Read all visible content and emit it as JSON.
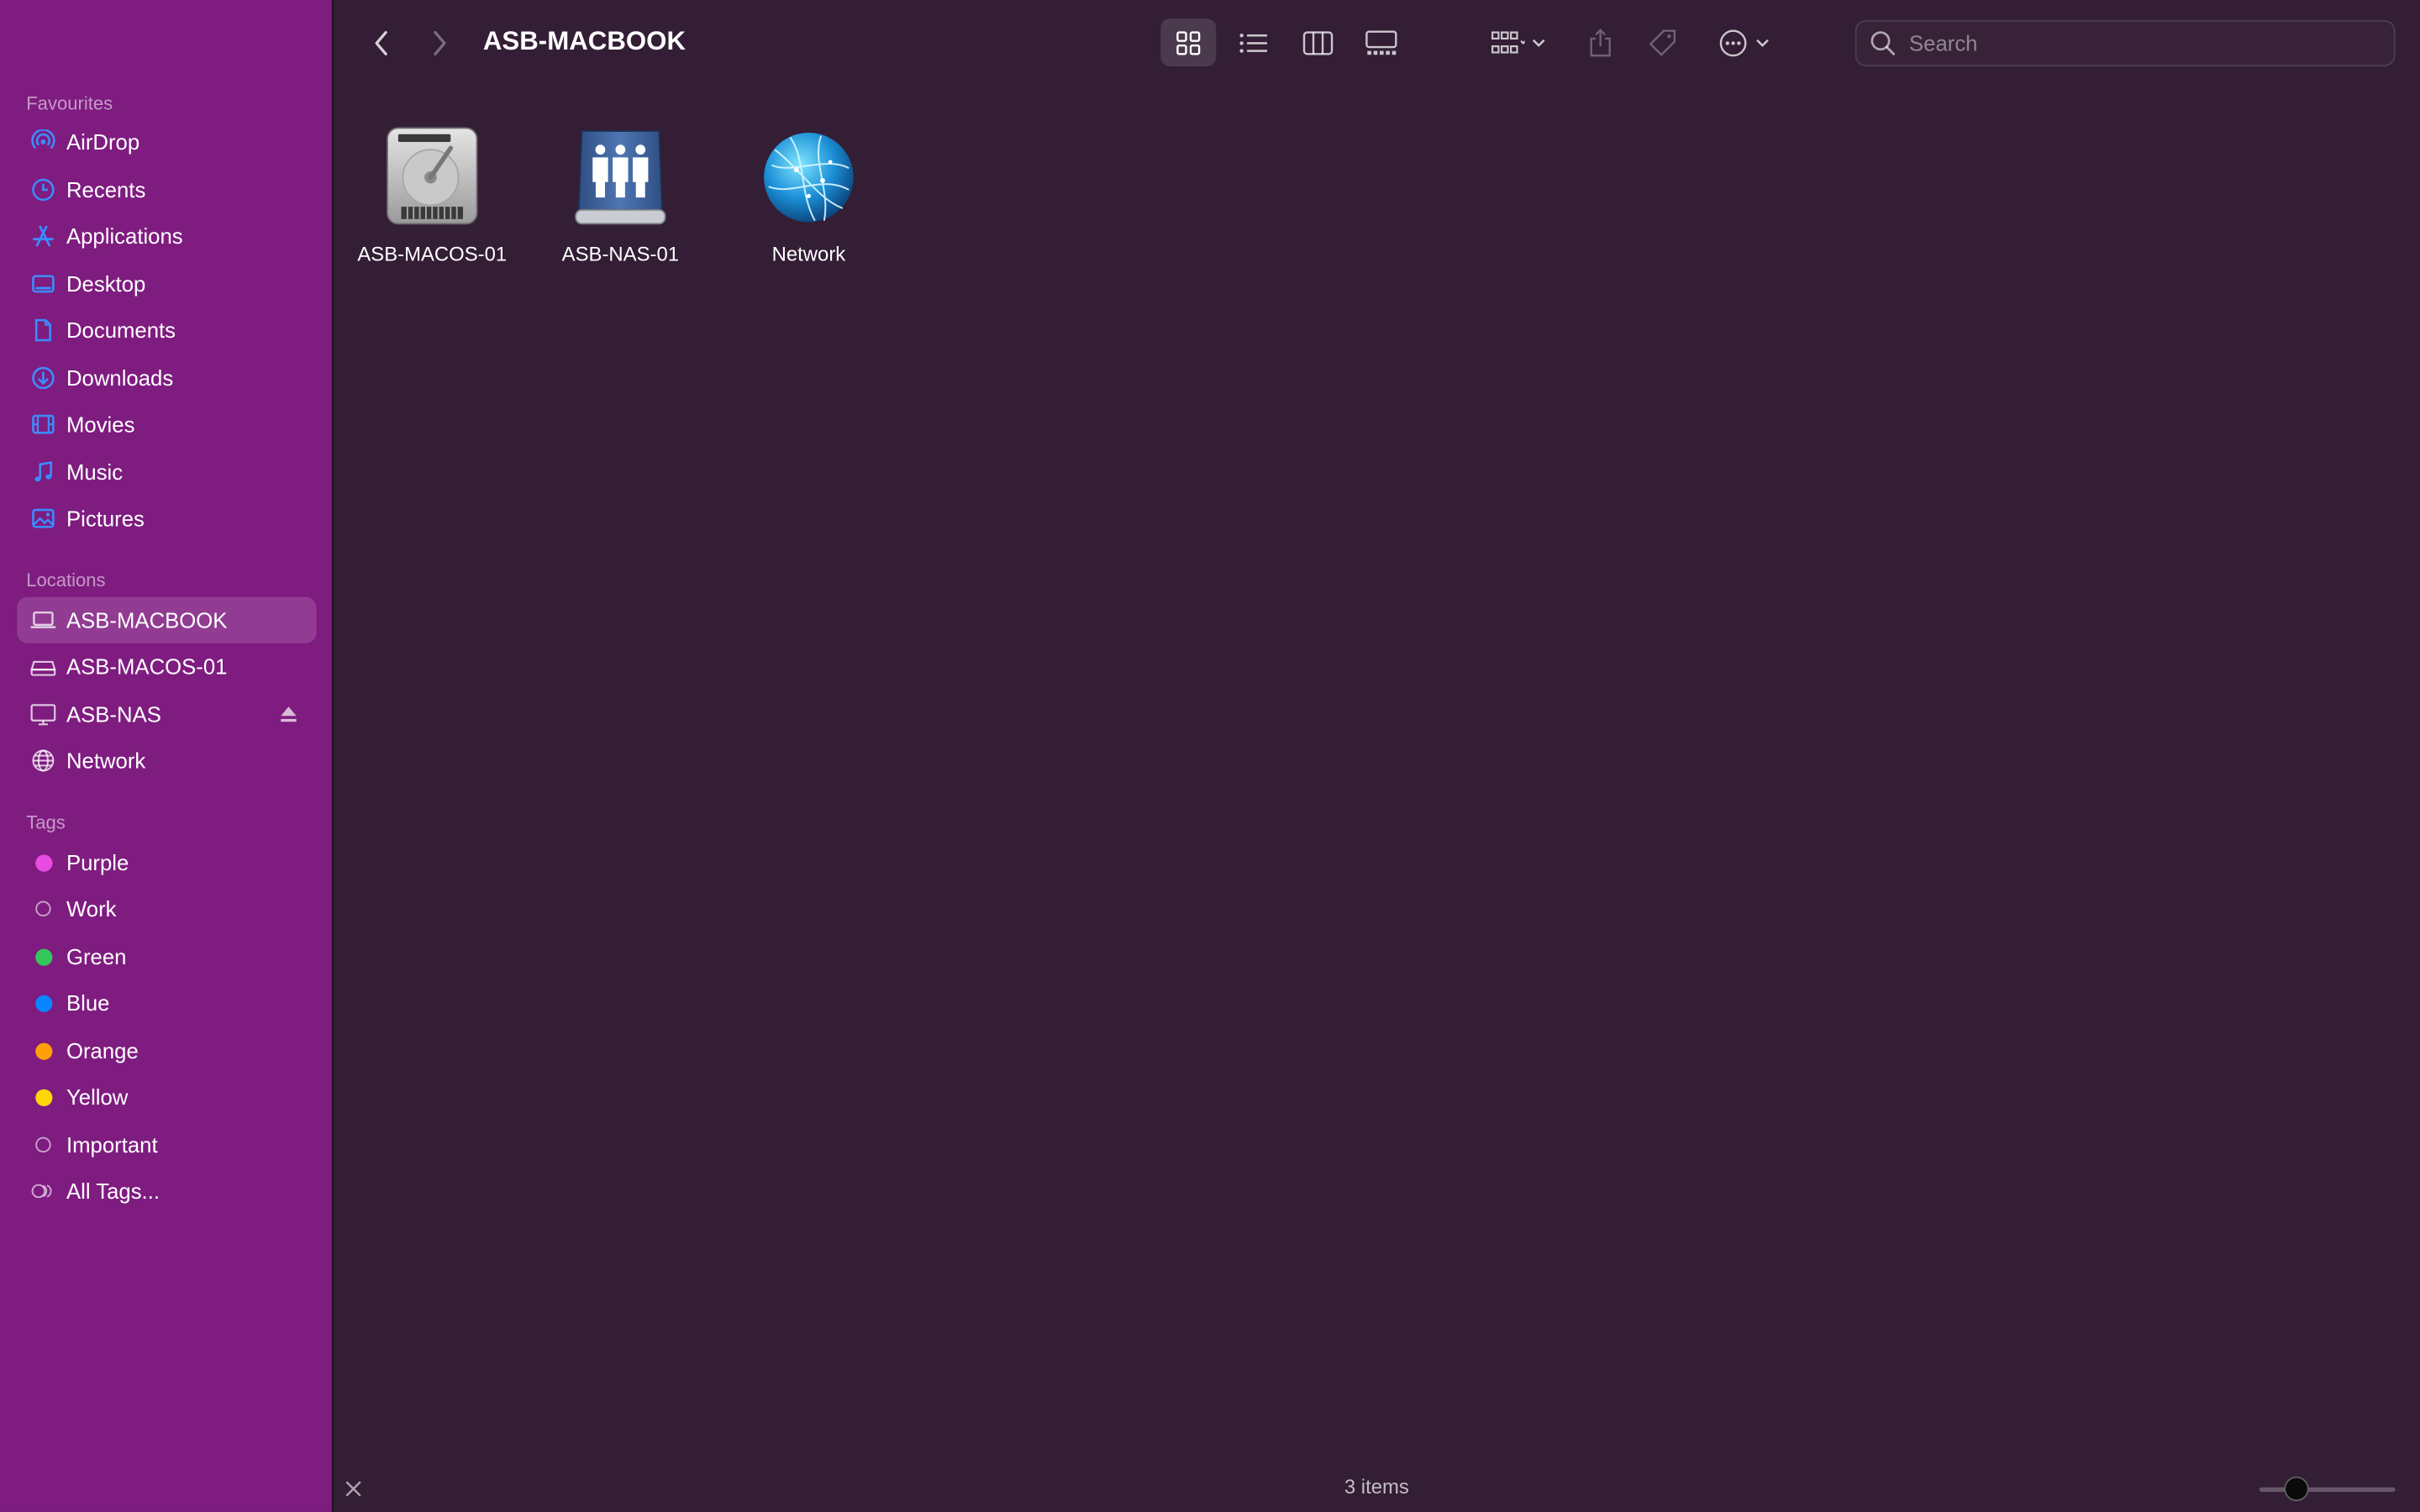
{
  "window": {
    "title": "ASB-MACBOOK",
    "search_placeholder": "Search",
    "status": "3 items"
  },
  "toolbar": {
    "back_icon": "chevron-left-icon",
    "forward_icon": "chevron-right-icon",
    "view_modes": [
      "icon-view",
      "list-view",
      "column-view",
      "gallery-view"
    ],
    "active_view": "icon-view",
    "group_icon": "group-by-icon",
    "share_icon": "share-icon",
    "tag_icon": "tag-icon",
    "more_icon": "more-icon"
  },
  "sidebar": {
    "favourites_title": "Favourites",
    "favourites": [
      {
        "label": "AirDrop",
        "icon": "airdrop-icon"
      },
      {
        "label": "Recents",
        "icon": "clock-icon"
      },
      {
        "label": "Applications",
        "icon": "applications-icon"
      },
      {
        "label": "Desktop",
        "icon": "desktop-icon"
      },
      {
        "label": "Documents",
        "icon": "document-icon"
      },
      {
        "label": "Downloads",
        "icon": "download-icon"
      },
      {
        "label": "Movies",
        "icon": "film-icon"
      },
      {
        "label": "Music",
        "icon": "music-note-icon"
      },
      {
        "label": "Pictures",
        "icon": "photo-icon"
      }
    ],
    "locations_title": "Locations",
    "locations": [
      {
        "label": "ASB-MACBOOK",
        "icon": "laptop-icon",
        "selected": true
      },
      {
        "label": "ASB-MACOS-01",
        "icon": "drive-icon"
      },
      {
        "label": "ASB-NAS",
        "icon": "monitor-icon"
      },
      {
        "label": "Network",
        "icon": "globe-icon"
      }
    ],
    "tags_title": "Tags",
    "tags": [
      {
        "label": "Purple",
        "color": "#e94ce0"
      },
      {
        "label": "Work",
        "color": ""
      },
      {
        "label": "Green",
        "color": "#34c759"
      },
      {
        "label": "Blue",
        "color": "#0a84ff"
      },
      {
        "label": "Orange",
        "color": "#ff9f0a"
      },
      {
        "label": "Yellow",
        "color": "#ffd60a"
      },
      {
        "label": "Important",
        "color": ""
      },
      {
        "label": "All Tags...",
        "color": ""
      }
    ]
  },
  "items": [
    {
      "label": "ASB-MACOS-01",
      "icon": "hard-disk-icon"
    },
    {
      "label": "ASB-NAS-01",
      "icon": "shared-server-icon"
    },
    {
      "label": "Network",
      "icon": "network-globe-icon"
    }
  ],
  "colors": {
    "sidebar_bg": "#7f1c80",
    "content_bg": "#331e35",
    "accent": "#0a84ff"
  }
}
